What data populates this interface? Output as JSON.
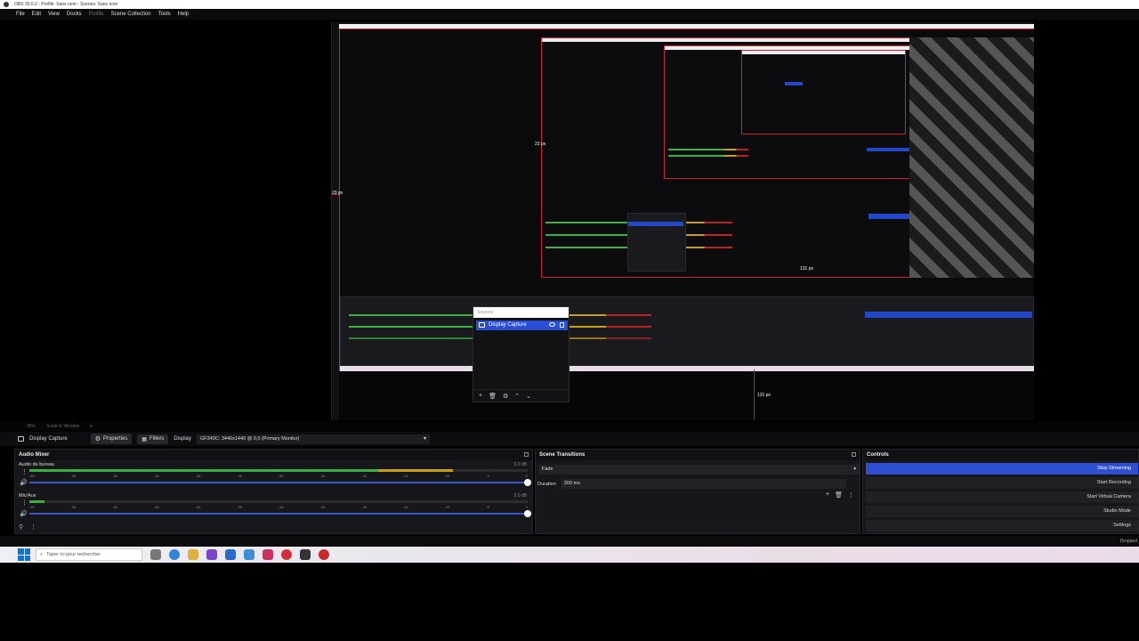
{
  "window": {
    "title": "OBS 30.0.2 - Profile: Sans nom - Scenes: Sans nom"
  },
  "menu": {
    "items": [
      "File",
      "Edit",
      "View",
      "Docks",
      "Profile",
      "Scene Collection",
      "Tools",
      "Help"
    ]
  },
  "preview": {
    "px_left": "23 px",
    "px_bottom": "131 px",
    "px_nested_left": "23 px",
    "px_nested_bottom": "131 px"
  },
  "sources_popup": {
    "header": "Sources",
    "item": "Display Capture"
  },
  "scale_bar": {
    "zoom": "95%",
    "mode": "Scale to Window"
  },
  "source_toolbar": {
    "source_name": "Display Capture",
    "properties_label": "Properties",
    "filters_label": "Filters",
    "display_label": "Display",
    "display_value": "GF340C: 3440x1440 @ 0,0 (Primary Monitor)"
  },
  "audio_mixer": {
    "title": "Audio Mixer",
    "channels": [
      {
        "name": "Audio du bureau",
        "db": "0.0 dB",
        "level": 0.85
      },
      {
        "name": "Mic/Aux",
        "db": "0.0 dB",
        "level": 0.03
      }
    ],
    "ticks": [
      "-60",
      "-55",
      "-50",
      "-45",
      "-40",
      "-35",
      "-30",
      "-25",
      "-20",
      "-15",
      "-10",
      "-5",
      "0"
    ]
  },
  "scene_transitions": {
    "title": "Scene Transitions",
    "transition": "Fade",
    "duration_label": "Duration",
    "duration_value": "300 ms"
  },
  "controls": {
    "title": "Controls",
    "buttons": [
      "Stop Streaming",
      "Start Recording",
      "Start Virtual Camera",
      "Studio Mode",
      "Settings"
    ]
  },
  "status": {
    "dropped": "Dropped"
  },
  "taskbar": {
    "search_placeholder": "Taper ici pour rechercher"
  },
  "colors": {
    "accent": "#2d4fd0",
    "guide": "#d1132b",
    "meter_green": "#3cb043",
    "meter_yellow": "#c8a016",
    "meter_red": "#b22222"
  }
}
